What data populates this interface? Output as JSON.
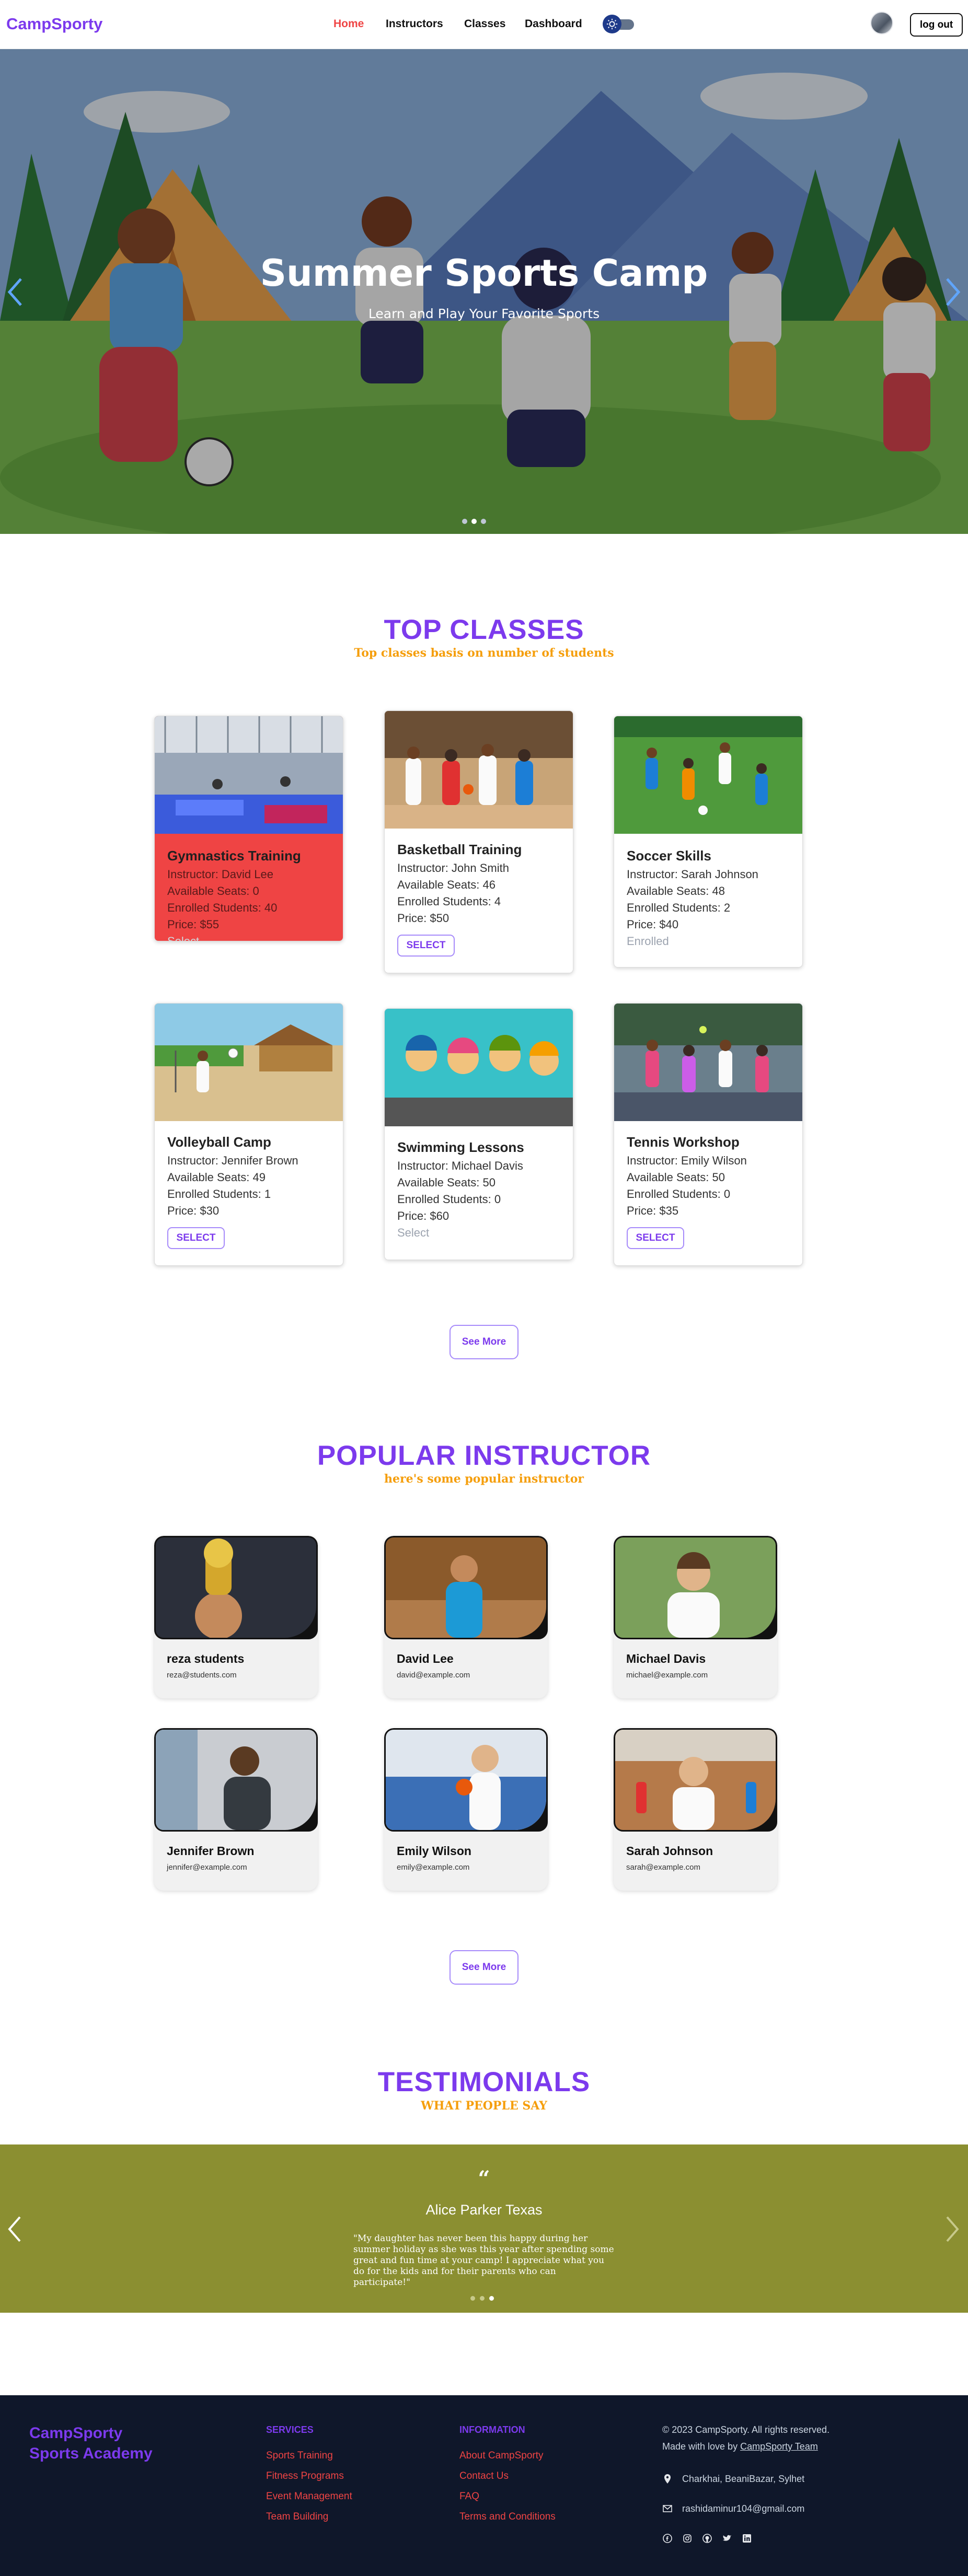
{
  "nav": {
    "logo": "CampSporty",
    "links": [
      "Home",
      "Instructors",
      "Classes",
      "Dashboard"
    ],
    "logout": "log out"
  },
  "hero": {
    "title": "Summer Sports Camp",
    "subtitle": "Learn and Play Your Favorite Sports",
    "active_slide": 1,
    "slides": 3
  },
  "top_classes": {
    "title": "TOP CLASSES",
    "subtitle": "Top classes basis on number of students",
    "cards": [
      {
        "name": "Gymnastics Training",
        "instructor": "Instructor: David Lee",
        "seats": "Available Seats: 0",
        "enrolled": "Enrolled Students: 40",
        "price": "Price: $55",
        "action": "Select"
      },
      {
        "name": "Basketball Training",
        "instructor": "Instructor: John Smith",
        "seats": "Available Seats: 46",
        "enrolled": "Enrolled Students: 4",
        "price": "Price: $50",
        "action": "SELECT"
      },
      {
        "name": "Soccer Skills",
        "instructor": "Instructor: Sarah Johnson",
        "seats": "Available Seats: 48",
        "enrolled": "Enrolled Students: 2",
        "price": "Price: $40",
        "action": "Enrolled"
      },
      {
        "name": "Volleyball Camp",
        "instructor": "Instructor: Jennifer Brown",
        "seats": "Available Seats: 49",
        "enrolled": "Enrolled Students: 1",
        "price": "Price: $30",
        "action": "SELECT"
      },
      {
        "name": "Swimming Lessons",
        "instructor": "Instructor: Michael Davis",
        "seats": "Available Seats: 50",
        "enrolled": "Enrolled Students: 0",
        "price": "Price: $60",
        "action": "Select"
      },
      {
        "name": "Tennis Workshop",
        "instructor": "Instructor: Emily Wilson",
        "seats": "Available Seats: 50",
        "enrolled": "Enrolled Students: 0",
        "price": "Price: $35",
        "action": "SELECT"
      }
    ],
    "see_more": "See More"
  },
  "instructors": {
    "title": "POPULAR INSTRUCTOR",
    "subtitle": "here's some popular instructor",
    "items": [
      {
        "name": "reza students",
        "email": "reza@students.com"
      },
      {
        "name": "David Lee",
        "email": "david@example.com"
      },
      {
        "name": "Michael Davis",
        "email": "michael@example.com"
      },
      {
        "name": "Jennifer Brown",
        "email": "jennifer@example.com"
      },
      {
        "name": "Emily Wilson",
        "email": "emily@example.com"
      },
      {
        "name": "Sarah Johnson",
        "email": "sarah@example.com"
      }
    ],
    "see_more": "See More"
  },
  "testimonials": {
    "title": "TESTIMONIALS",
    "subtitle": "WHAT PEOPLE SAY",
    "quote_mark": "“",
    "name": "Alice Parker Texas",
    "text": "\"My daughter has never been this happy during her summer holiday as she was this year after spending some great and fun time at your camp! I appreciate what you do for the kids and for their parents who can participate!\"",
    "active_slide": 2,
    "slides": 3
  },
  "footer": {
    "brand_line1": "CampSporty",
    "brand_line2": "Sports Academy",
    "services_heading": "SERVICES",
    "services": [
      "Sports Training",
      "Fitness Programs",
      "Event Management",
      "Team Building"
    ],
    "info_heading": "INFORMATION",
    "info": [
      "About CampSporty",
      "Contact Us",
      "FAQ",
      "Terms and Conditions"
    ],
    "copyright": "© 2023 CampSporty. All rights reserved.",
    "made_with": "Made with love by",
    "team": "CampSporty Team",
    "address": "Charkhai, BeaniBazar, Sylhet",
    "email": "rashidaminur104@gmail.com",
    "social": [
      "facebook-icon",
      "instagram-icon",
      "github-icon",
      "twitter-icon",
      "linkedin-icon"
    ]
  },
  "colors": {
    "brand": "#7c3aed",
    "accent": "#ef4444",
    "gold": "#f59e0b",
    "testimonial_bg": "#8b8f31",
    "footer_bg": "#0f172a"
  }
}
